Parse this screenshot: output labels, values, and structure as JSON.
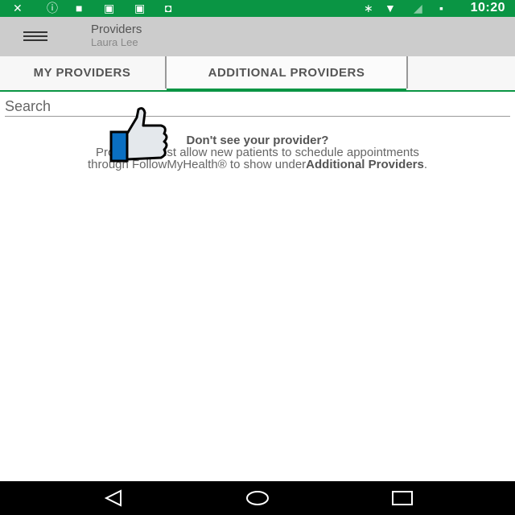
{
  "status_bar": {
    "time": "10:20",
    "icons": [
      "no-sim-icon",
      "alert-icon",
      "lock-icon",
      "briefcase-check-icon",
      "briefcase-play-icon",
      "android-icon",
      "bluetooth-icon",
      "wifi-icon",
      "signal-off-icon",
      "battery-charging-icon"
    ]
  },
  "app_bar": {
    "title": "Providers",
    "subtitle": "Laura Lee"
  },
  "tabs": [
    {
      "label": "MY PROVIDERS",
      "active": false
    },
    {
      "label": "ADDITIONAL PROVIDERS",
      "active": true
    }
  ],
  "search": {
    "placeholder": "Search",
    "value": ""
  },
  "message": {
    "heading": "Don't see your provider?",
    "line1": "Providers must allow new patients to schedule appointments",
    "line2_prefix": "through FollowMyHealth® to show under",
    "line2_bold": "Additional Providers",
    "line2_suffix": "."
  },
  "colors": {
    "accent": "#0a9544",
    "app_bar": "#cccccc",
    "thumb_cuff": "#0a6fc2"
  }
}
